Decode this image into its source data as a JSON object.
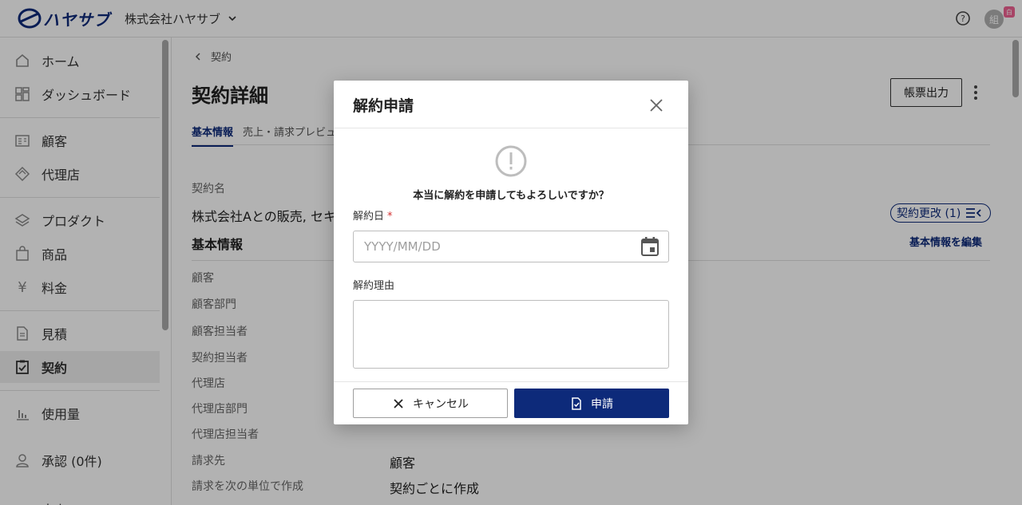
{
  "header": {
    "logo_text": "ハヤサブ",
    "company": "株式会社ハヤサブ",
    "avatar_text": "組",
    "avatar_badge": "白"
  },
  "sidebar": {
    "items": [
      {
        "label": "ホーム",
        "icon": "home-icon"
      },
      {
        "label": "ダッシュボード",
        "icon": "dashboard-icon"
      },
      {
        "label": "顧客",
        "icon": "customer-icon"
      },
      {
        "label": "代理店",
        "icon": "agency-icon"
      },
      {
        "label": "プロダクト",
        "icon": "layers-icon"
      },
      {
        "label": "商品",
        "icon": "bag-icon"
      },
      {
        "label": "料金",
        "icon": "yen-icon"
      },
      {
        "label": "見積",
        "icon": "document-icon"
      },
      {
        "label": "契約",
        "icon": "clipboard-check-icon"
      },
      {
        "label": "使用量",
        "icon": "bar-chart-icon"
      },
      {
        "label": "承認 (0件)",
        "icon": "person-icon"
      },
      {
        "label": "売上",
        "icon": "sales-icon"
      }
    ],
    "active": "契約"
  },
  "main": {
    "breadcrumb": "契約",
    "title": "契約詳細",
    "export_button": "帳票出力",
    "tabs": [
      "基本情報",
      "売上・請求プレビュー"
    ],
    "contract_name_label": "契約名",
    "contract_name_value": "株式会社Aとの販売, セキ",
    "change_badge": "契約更改 (1)",
    "section_title": "基本情報",
    "edit_link": "基本情報を編集",
    "fields": [
      {
        "label": "顧客",
        "value": ""
      },
      {
        "label": "顧客部門",
        "value": ""
      },
      {
        "label": "顧客担当者",
        "value": ""
      },
      {
        "label": "契約担当者",
        "value": ""
      },
      {
        "label": "代理店",
        "value": ""
      },
      {
        "label": "代理店部門",
        "value": ""
      },
      {
        "label": "代理店担当者",
        "value": ""
      },
      {
        "label": "請求先",
        "value": "顧客"
      },
      {
        "label": "請求を次の単位で作成",
        "value": "契約ごとに作成"
      }
    ]
  },
  "modal": {
    "title": "解約申請",
    "confirm_text": "本当に解約を申請してもよろしいですか？",
    "date_label": "解約日",
    "required_mark": "*",
    "date_placeholder": "YYYY/MM/DD",
    "date_value": "",
    "reason_label": "解約理由",
    "reason_value": "",
    "cancel_button": "キャンセル",
    "apply_button": "申請"
  },
  "colors": {
    "brand": "#0d2a7a",
    "required": "#d32f2f"
  }
}
